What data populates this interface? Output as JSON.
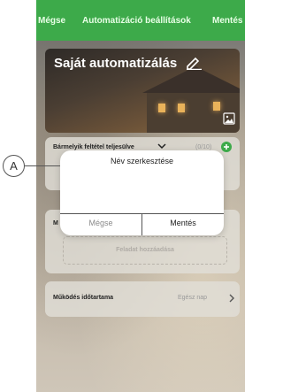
{
  "topbar": {
    "cancel_label": "Mégse",
    "title": "Automatizáció beállítások",
    "save_label": "Mentés"
  },
  "header": {
    "title": "Saját automatizálás"
  },
  "condition": {
    "label": "Bármelyik feltétel teljesülve",
    "count": "(0/10)"
  },
  "task": {
    "label": "M",
    "add_label": "Feladat hozzáadása"
  },
  "duration": {
    "label": "Működés időtartama",
    "value": "Egész nap"
  },
  "dialog": {
    "title": "Név szerkesztése",
    "input_value": "",
    "cancel_label": "Mégse",
    "save_label": "Mentés"
  },
  "callout": {
    "label": "A"
  },
  "colors": {
    "accent": "#3daa4a"
  },
  "icons": [
    "edit-icon",
    "image-icon",
    "chevron-down-icon",
    "plus-icon",
    "chevron-right-icon"
  ]
}
